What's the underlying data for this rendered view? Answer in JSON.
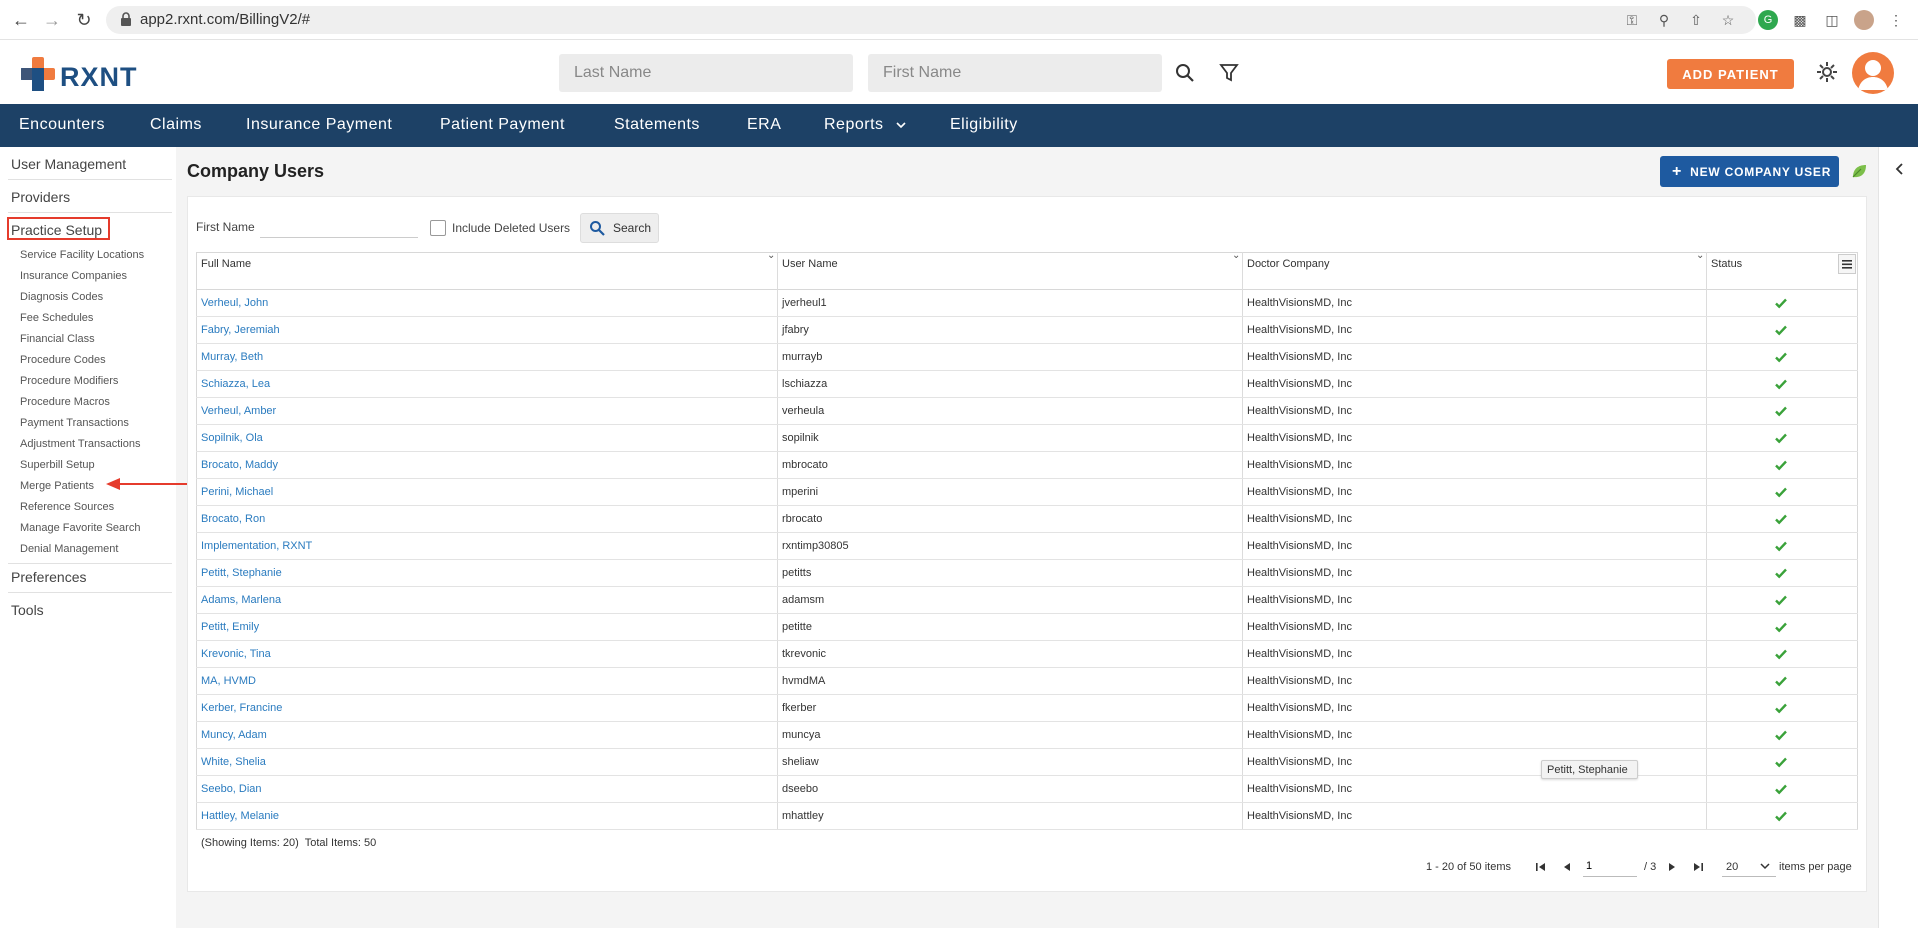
{
  "browser": {
    "url": "app2.rxnt.com/BillingV2/#"
  },
  "header": {
    "logo_text": "RXNT",
    "last_name_placeholder": "Last Name",
    "first_name_placeholder": "First Name",
    "add_patient_label": "ADD PATIENT",
    "accent_color": "#f07b3f",
    "brand_color": "#1e4f82"
  },
  "nav": {
    "items": [
      "Encounters",
      "Claims",
      "Insurance Payment",
      "Patient Payment",
      "Statements",
      "ERA",
      "Reports",
      "Eligibility"
    ]
  },
  "sidebar": {
    "top_items": [
      "User Management",
      "Providers",
      "Practice Setup",
      "Preferences",
      "Tools"
    ],
    "practice_setup_items": [
      "Service Facility Locations",
      "Insurance Companies",
      "Diagnosis Codes",
      "Fee Schedules",
      "Financial Class",
      "Procedure Codes",
      "Procedure Modifiers",
      "Procedure Macros",
      "Payment Transactions",
      "Adjustment Transactions",
      "Superbill Setup",
      "Merge Patients",
      "Reference Sources",
      "Manage Favorite Search",
      "Denial Management"
    ],
    "highlighted_item": "Practice Setup",
    "pointed_item": "Merge Patients"
  },
  "page": {
    "title": "Company Users",
    "new_user_label": "NEW COMPANY USER"
  },
  "filter": {
    "first_name_label": "First Name",
    "first_name_value": "",
    "include_deleted_label": "Include Deleted Users",
    "include_deleted_checked": false,
    "search_label": "Search"
  },
  "table": {
    "columns": [
      "Full Name",
      "User Name",
      "Doctor Company",
      "Status"
    ],
    "rows": [
      {
        "full_name": "Verheul, John",
        "user_name": "jverheul1",
        "company": "HealthVisionsMD, Inc",
        "status": "active"
      },
      {
        "full_name": "Fabry, Jeremiah",
        "user_name": "jfabry",
        "company": "HealthVisionsMD, Inc",
        "status": "active"
      },
      {
        "full_name": "Murray, Beth",
        "user_name": "murrayb",
        "company": "HealthVisionsMD, Inc",
        "status": "active"
      },
      {
        "full_name": "Schiazza, Lea",
        "user_name": "lschiazza",
        "company": "HealthVisionsMD, Inc",
        "status": "active"
      },
      {
        "full_name": "Verheul, Amber",
        "user_name": "verheula",
        "company": "HealthVisionsMD, Inc",
        "status": "active"
      },
      {
        "full_name": "Sopilnik, Ola",
        "user_name": "sopilnik",
        "company": "HealthVisionsMD, Inc",
        "status": "active"
      },
      {
        "full_name": "Brocato, Maddy",
        "user_name": "mbrocato",
        "company": "HealthVisionsMD, Inc",
        "status": "active"
      },
      {
        "full_name": "Perini, Michael",
        "user_name": "mperini",
        "company": "HealthVisionsMD, Inc",
        "status": "active"
      },
      {
        "full_name": "Brocato, Ron",
        "user_name": "rbrocato",
        "company": "HealthVisionsMD, Inc",
        "status": "active"
      },
      {
        "full_name": "Implementation, RXNT",
        "user_name": "rxntimp30805",
        "company": "HealthVisionsMD, Inc",
        "status": "active"
      },
      {
        "full_name": "Petitt, Stephanie",
        "user_name": "petitts",
        "company": "HealthVisionsMD, Inc",
        "status": "active"
      },
      {
        "full_name": "Adams, Marlena",
        "user_name": "adamsm",
        "company": "HealthVisionsMD, Inc",
        "status": "active"
      },
      {
        "full_name": "Petitt, Emily",
        "user_name": "petitte",
        "company": "HealthVisionsMD, Inc",
        "status": "active"
      },
      {
        "full_name": "Krevonic, Tina",
        "user_name": "tkrevonic",
        "company": "HealthVisionsMD, Inc",
        "status": "active"
      },
      {
        "full_name": "MA, HVMD",
        "user_name": "hvmdMA",
        "company": "HealthVisionsMD, Inc",
        "status": "active"
      },
      {
        "full_name": "Kerber, Francine",
        "user_name": "fkerber",
        "company": "HealthVisionsMD, Inc",
        "status": "active"
      },
      {
        "full_name": "Muncy, Adam",
        "user_name": "muncya",
        "company": "HealthVisionsMD, Inc",
        "status": "active"
      },
      {
        "full_name": "White, Shelia",
        "user_name": "sheliaw",
        "company": "HealthVisionsMD, Inc",
        "status": "active"
      },
      {
        "full_name": "Seebo, Dian",
        "user_name": "dseebo",
        "company": "HealthVisionsMD, Inc",
        "status": "active"
      },
      {
        "full_name": "Hattley, Melanie",
        "user_name": "mhattley",
        "company": "HealthVisionsMD, Inc",
        "status": "active"
      }
    ],
    "status_color": "#3aa23a",
    "tooltip": "Petitt, Stephanie"
  },
  "footer": {
    "showing": "(Showing Items: 20)",
    "total": "Total Items: 50",
    "range": "1 - 20 of 50 items",
    "page_value": "1",
    "page_total": "/ 3",
    "per_page_value": "20",
    "per_page_label": "items per page"
  }
}
